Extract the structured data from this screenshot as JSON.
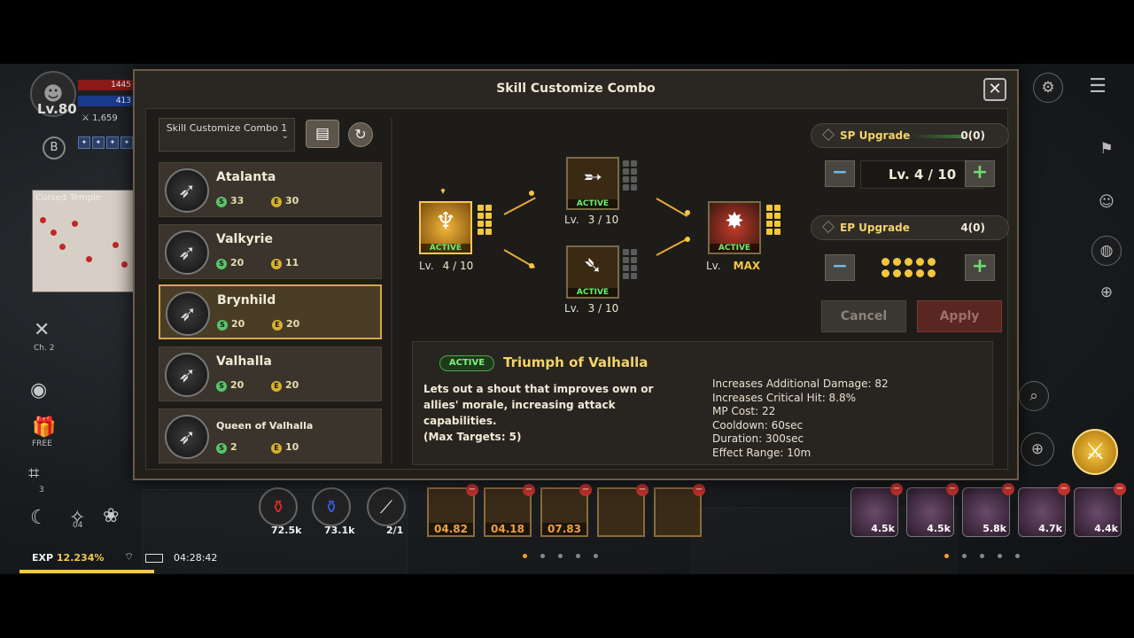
{
  "hud": {
    "level": "Lv.80",
    "hp": "1445",
    "mp": "413",
    "power": "1,659",
    "badge": "B",
    "map_title": "Cursed Temple",
    "channel": "Ch. 2",
    "free_label": "FREE",
    "cam_count": "3",
    "pet_count": "04",
    "exp_label": "EXP",
    "exp_value": "12.234%",
    "exp_progress": 0.12234,
    "clock": "04:28:42"
  },
  "potions": [
    {
      "label": "72.5k",
      "icon": "red-potion-icon"
    },
    {
      "label": "73.1k",
      "icon": "blue-potion-icon"
    },
    {
      "label": "2/1",
      "icon": "feather-icon"
    }
  ],
  "quickslots": [
    {
      "cd": "04.82"
    },
    {
      "cd": "04.18"
    },
    {
      "cd": "07.83"
    },
    {
      "cd": ""
    },
    {
      "cd": ""
    }
  ],
  "right_slots": [
    {
      "label": "4.5k"
    },
    {
      "label": "4.5k"
    },
    {
      "label": "5.8k"
    },
    {
      "label": "4.7k"
    },
    {
      "label": "4.4k"
    }
  ],
  "dialog": {
    "title": "Skill Customize Combo",
    "combo_select": "Skill Customize Combo 1",
    "skills": [
      {
        "name": "Atalanta",
        "sp": "33",
        "ep": "30",
        "selected": false
      },
      {
        "name": "Valkyrie",
        "sp": "20",
        "ep": "11",
        "selected": false
      },
      {
        "name": "Brynhild",
        "sp": "20",
        "ep": "20",
        "selected": true
      },
      {
        "name": "Valhalla",
        "sp": "20",
        "ep": "20",
        "selected": false
      },
      {
        "name": "Queen of Valhalla",
        "sp": "2",
        "ep": "10",
        "selected": false
      }
    ],
    "tree": {
      "base": {
        "lv_label": "Lv.",
        "lv": "4 / 10",
        "active": "ACTIVE"
      },
      "top": {
        "lv_label": "Lv.",
        "lv": "3 / 10",
        "active": "ACTIVE"
      },
      "bottom": {
        "lv_label": "Lv.",
        "lv": "3 / 10",
        "active": "ACTIVE"
      },
      "final": {
        "lv_label": "Lv.",
        "lv": "MAX",
        "active": "ACTIVE"
      }
    },
    "sp_upgrade": {
      "label": "SP Upgrade",
      "value": "0(0)"
    },
    "ep_upgrade": {
      "label": "EP Upgrade",
      "value": "4(0)"
    },
    "level_display": "Lv.  4 / 10",
    "cancel": "Cancel",
    "apply": "Apply",
    "description": {
      "badge": "ACTIVE",
      "title": "Triumph of Valhalla",
      "text": "Lets out a shout that improves own or\nallies' morale, increasing attack\ncapabilities.\n(Max Targets: 5)",
      "stats": [
        "Increases Additional Damage: 82",
        "Increases Critical Hit: 8.8%",
        "MP Cost: 22",
        "Cooldown: 60sec",
        "Duration: 300sec",
        "Effect Range: 10m"
      ]
    }
  }
}
